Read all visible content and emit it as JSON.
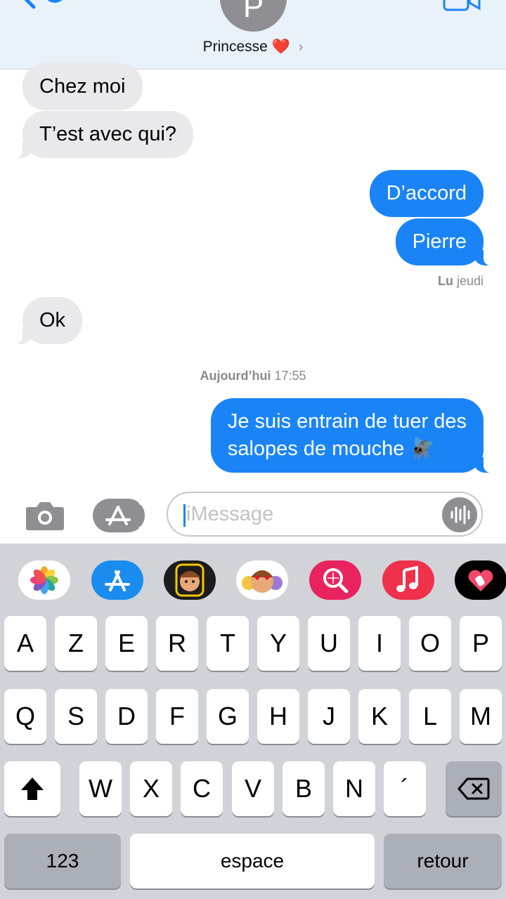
{
  "header": {
    "avatar_initial": "P",
    "contact_name": "Princesse",
    "contact_emoji": "❤️",
    "chevron": "›"
  },
  "messages": [
    {
      "direction": "in",
      "text": "Chez moi"
    },
    {
      "direction": "in",
      "text": "T’est avec qui?"
    },
    {
      "direction": "out",
      "text": "D’accord"
    },
    {
      "direction": "out",
      "text": "Pierre"
    },
    {
      "direction": "in",
      "text": "Ok"
    },
    {
      "direction": "out",
      "text_line1": "Je suis entrain de tuer des",
      "text_line2": "salopes de mouche 🪰"
    }
  ],
  "read_receipt": {
    "label": "Lu",
    "day": "jeudi"
  },
  "timestamp": {
    "day": "Aujourd’hui",
    "time": "17:55"
  },
  "input": {
    "placeholder": "iMessage"
  },
  "app_drawer": [
    {
      "name": "photos",
      "icon": "photos-icon"
    },
    {
      "name": "app-store",
      "icon": "app-store-icon"
    },
    {
      "name": "memoji-camera",
      "icon": "memoji-camera-icon"
    },
    {
      "name": "memoji-stickers",
      "icon": "memoji-stickers-icon"
    },
    {
      "name": "images-search",
      "icon": "image-search-icon"
    },
    {
      "name": "music",
      "icon": "music-icon"
    },
    {
      "name": "digital-touch",
      "icon": "digital-touch-icon"
    }
  ],
  "keyboard": {
    "row1": [
      "A",
      "Z",
      "E",
      "R",
      "T",
      "Y",
      "U",
      "I",
      "O",
      "P"
    ],
    "row2": [
      "Q",
      "S",
      "D",
      "F",
      "G",
      "H",
      "J",
      "K",
      "L",
      "M"
    ],
    "row3": [
      "W",
      "X",
      "C",
      "V",
      "B",
      "N",
      "´"
    ],
    "numbers_label": "123",
    "space_label": "espace",
    "return_label": "retour"
  },
  "colors": {
    "sent_bubble": "#1a84f7",
    "received_bubble": "#e9e9eb",
    "header_bg": "#e9f1f9",
    "keyboard_bg": "#d1d3d9"
  }
}
